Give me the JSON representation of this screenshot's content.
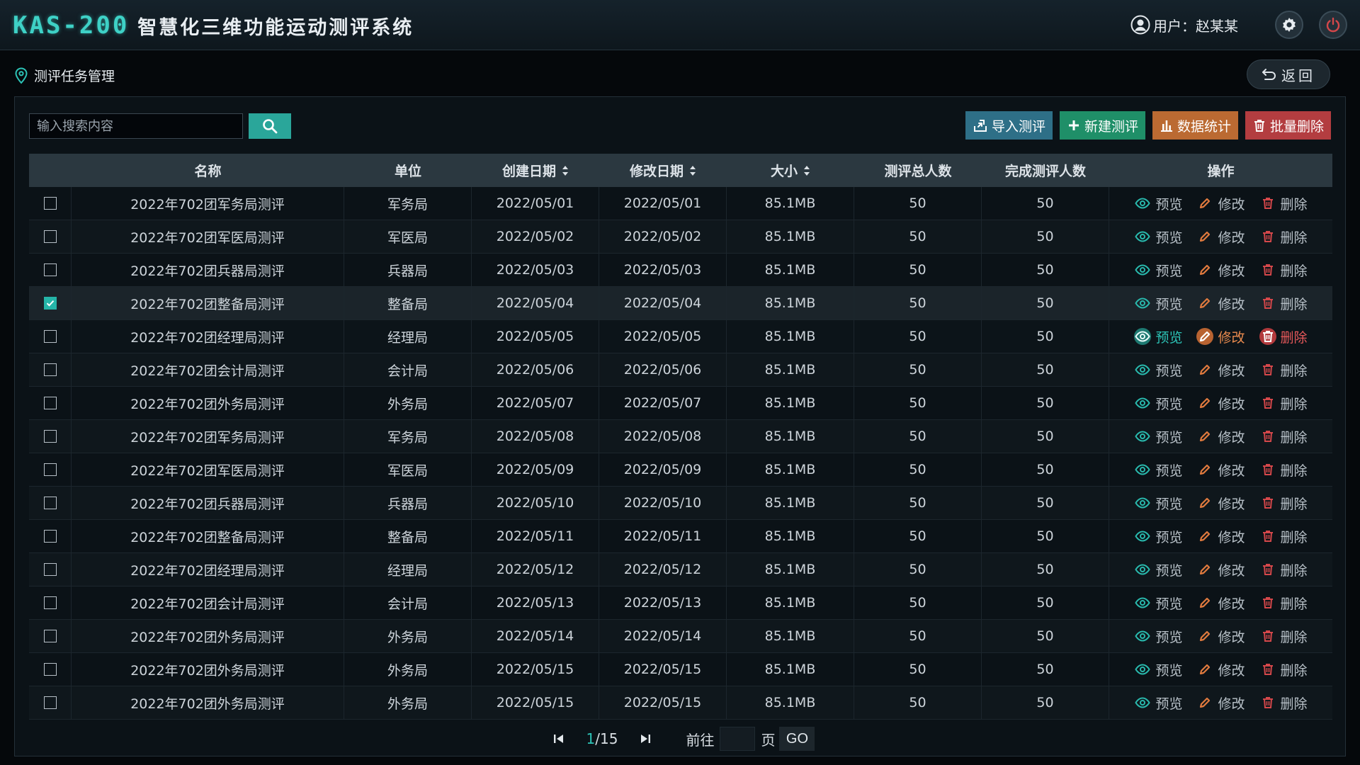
{
  "header": {
    "brand_code": "KAS-200",
    "brand_name": "智慧化三维功能运动测评系统",
    "user_label": "用户：赵某某"
  },
  "breadcrumb": {
    "title": "测评任务管理",
    "back_label": "返回"
  },
  "search": {
    "placeholder": "输入搜索内容",
    "value": ""
  },
  "toolbar": {
    "import_label": "导入测评",
    "create_label": "新建测评",
    "stats_label": "数据统计",
    "batch_delete_label": "批量删除"
  },
  "table": {
    "columns": [
      "名称",
      "单位",
      "创建日期",
      "修改日期",
      "大小",
      "测评总人数",
      "完成测评人数",
      "操作"
    ],
    "actions": {
      "view": "预览",
      "edit": "修改",
      "delete": "删除"
    },
    "rows": [
      {
        "name": "2022年702团军务局测评",
        "unit": "军务局",
        "created": "2022/05/01",
        "modified": "2022/05/01",
        "size": "85.1MB",
        "total": "50",
        "done": "50",
        "checked": false
      },
      {
        "name": "2022年702团军医局测评",
        "unit": "军医局",
        "created": "2022/05/02",
        "modified": "2022/05/02",
        "size": "85.1MB",
        "total": "50",
        "done": "50",
        "checked": false
      },
      {
        "name": "2022年702团兵器局测评",
        "unit": "兵器局",
        "created": "2022/05/03",
        "modified": "2022/05/03",
        "size": "85.1MB",
        "total": "50",
        "done": "50",
        "checked": false
      },
      {
        "name": "2022年702团整备局测评",
        "unit": "整备局",
        "created": "2022/05/04",
        "modified": "2022/05/04",
        "size": "85.1MB",
        "total": "50",
        "done": "50",
        "checked": true
      },
      {
        "name": "2022年702团经理局测评",
        "unit": "经理局",
        "created": "2022/05/05",
        "modified": "2022/05/05",
        "size": "85.1MB",
        "total": "50",
        "done": "50",
        "checked": false
      },
      {
        "name": "2022年702团会计局测评",
        "unit": "会计局",
        "created": "2022/05/06",
        "modified": "2022/05/06",
        "size": "85.1MB",
        "total": "50",
        "done": "50",
        "checked": false
      },
      {
        "name": "2022年702团外务局测评",
        "unit": "外务局",
        "created": "2022/05/07",
        "modified": "2022/05/07",
        "size": "85.1MB",
        "total": "50",
        "done": "50",
        "checked": false
      },
      {
        "name": "2022年702团军务局测评",
        "unit": "军务局",
        "created": "2022/05/08",
        "modified": "2022/05/08",
        "size": "85.1MB",
        "total": "50",
        "done": "50",
        "checked": false
      },
      {
        "name": "2022年702团军医局测评",
        "unit": "军医局",
        "created": "2022/05/09",
        "modified": "2022/05/09",
        "size": "85.1MB",
        "total": "50",
        "done": "50",
        "checked": false
      },
      {
        "name": "2022年702团兵器局测评",
        "unit": "兵器局",
        "created": "2022/05/10",
        "modified": "2022/05/10",
        "size": "85.1MB",
        "total": "50",
        "done": "50",
        "checked": false
      },
      {
        "name": "2022年702团整备局测评",
        "unit": "整备局",
        "created": "2022/05/11",
        "modified": "2022/05/11",
        "size": "85.1MB",
        "total": "50",
        "done": "50",
        "checked": false
      },
      {
        "name": "2022年702团经理局测评",
        "unit": "经理局",
        "created": "2022/05/12",
        "modified": "2022/05/12",
        "size": "85.1MB",
        "total": "50",
        "done": "50",
        "checked": false
      },
      {
        "name": "2022年702团会计局测评",
        "unit": "会计局",
        "created": "2022/05/13",
        "modified": "2022/05/13",
        "size": "85.1MB",
        "total": "50",
        "done": "50",
        "checked": false
      },
      {
        "name": "2022年702团外务局测评",
        "unit": "外务局",
        "created": "2022/05/14",
        "modified": "2022/05/14",
        "size": "85.1MB",
        "total": "50",
        "done": "50",
        "checked": false
      },
      {
        "name": "2022年702团外务局测评",
        "unit": "外务局",
        "created": "2022/05/15",
        "modified": "2022/05/15",
        "size": "85.1MB",
        "total": "50",
        "done": "50",
        "checked": false
      },
      {
        "name": "2022年702团外务局测评",
        "unit": "外务局",
        "created": "2022/05/15",
        "modified": "2022/05/15",
        "size": "85.1MB",
        "total": "50",
        "done": "50",
        "checked": false
      }
    ]
  },
  "pagination": {
    "current": "1",
    "total": "/15",
    "goto_label": "前往",
    "page_label": "页",
    "go_label": "GO",
    "goto_value": ""
  },
  "colors": {
    "accent": "#2aa69a",
    "brand": "#3ed1c6",
    "import": "#2e6f87",
    "create": "#1f8f68",
    "stats": "#bb6a32",
    "delete": "#b33d40"
  },
  "icons": [
    "user-icon",
    "settings-icon",
    "power-icon",
    "location-pin-icon",
    "back-arrow-icon",
    "search-icon",
    "import-icon",
    "plus-icon",
    "bar-chart-icon",
    "trash-icon",
    "eye-icon",
    "pencil-icon",
    "sort-icon",
    "first-page-icon",
    "last-page-icon",
    "check-icon"
  ]
}
